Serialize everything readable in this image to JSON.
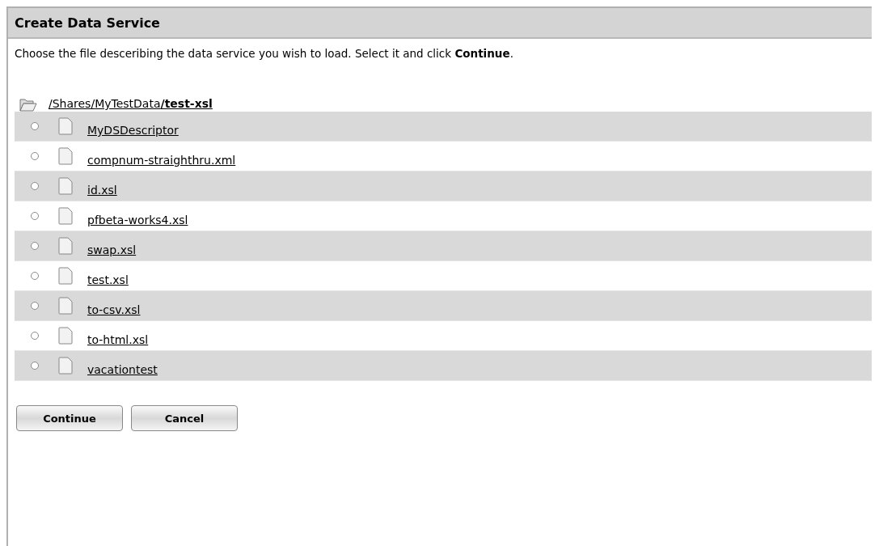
{
  "panel": {
    "title": "Create Data Service"
  },
  "instructions": "Choose the file desceribing the data service you wish to load. Select it and click **Continue**.",
  "path": [
    {
      "text": "/Shares",
      "current": false
    },
    {
      "text": "/",
      "current": false
    },
    {
      "text": "MyTestData",
      "current": false
    },
    {
      "text": "/test-xsl",
      "current": true
    }
  ],
  "files": [
    {
      "name": "MyDSDescriptor",
      "selected": false
    },
    {
      "name": "compnum-straighthru.xml",
      "selected": false
    },
    {
      "name": "id.xsl",
      "selected": false
    },
    {
      "name": "pfbeta-works4.xsl",
      "selected": false
    },
    {
      "name": "swap.xsl",
      "selected": false
    },
    {
      "name": "test.xsl",
      "selected": false
    },
    {
      "name": "to-csv.xsl",
      "selected": false
    },
    {
      "name": "to-html.xsl",
      "selected": false
    },
    {
      "name": "vacationtest",
      "selected": false
    }
  ],
  "buttons": [
    "Continue",
    "Cancel"
  ]
}
